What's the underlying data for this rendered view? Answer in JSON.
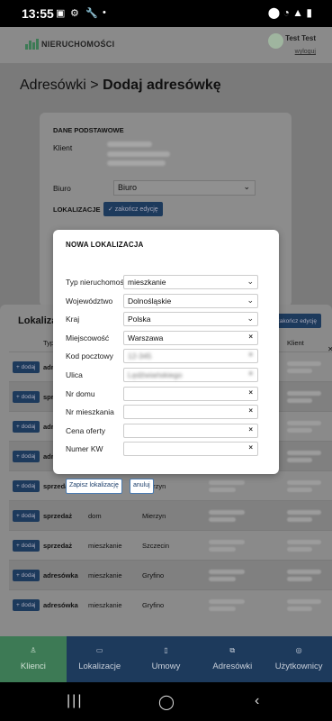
{
  "statusbar": {
    "time": "13:55",
    "dot": "•"
  },
  "header": {
    "logo_text": "NIERUCHOMOŚCI",
    "user_name": "Test Test",
    "logout": "wyloguj"
  },
  "breadcrumb": {
    "parent": "Adresówki",
    "separator": ">",
    "current": "Dodaj adresówkę"
  },
  "card": {
    "section_basic": "DANE PODSTAWOWE",
    "client_label": "Klient",
    "office_label": "Biuro",
    "office_value": "Biuro",
    "section_locations": "LOKALIZACJE",
    "finish_edit_label": "✓ zakończ edycję"
  },
  "panel": {
    "title": "Lokalizacje",
    "finish_edit_label": "✓ zakończ edycję",
    "columns": [
      "Typ",
      "Klient"
    ],
    "add_label": "+ dodaj",
    "rows": [
      {
        "type": "adresówka",
        "kind": "",
        "city": ""
      },
      {
        "type": "sprzedaż",
        "kind": "",
        "city": ""
      },
      {
        "type": "adresówka",
        "kind": "",
        "city": ""
      },
      {
        "type": "adresówka",
        "kind": "",
        "city": ""
      },
      {
        "type": "sprzedaż",
        "kind": "dom",
        "city": "Mierzyn"
      },
      {
        "type": "sprzedaż",
        "kind": "dom",
        "city": "Mierzyn"
      },
      {
        "type": "sprzedaż",
        "kind": "mieszkanie",
        "city": "Szczecin"
      },
      {
        "type": "adresówka",
        "kind": "mieszkanie",
        "city": "Gryfino"
      },
      {
        "type": "adresówka",
        "kind": "mieszkanie",
        "city": "Gryfino"
      }
    ]
  },
  "modal": {
    "title": "NOWA LOKALIZACJA",
    "fields": [
      {
        "label": "Typ nieruchomości",
        "value": "mieszkanie",
        "control": "select"
      },
      {
        "label": "Województwo",
        "value": "Dolnośląskie",
        "control": "select"
      },
      {
        "label": "Kraj",
        "value": "Polska",
        "control": "select"
      },
      {
        "label": "Miejscowość",
        "value": "Warszawa",
        "control": "clear"
      },
      {
        "label": "Kod pocztowy",
        "value": "12-345",
        "control": "clear"
      },
      {
        "label": "Ulica",
        "value": "Lędźwiańskiego",
        "control": "clear"
      },
      {
        "label": "Nr domu",
        "value": "",
        "control": "clear"
      },
      {
        "label": "Nr mieszkania",
        "value": "",
        "control": "clear"
      },
      {
        "label": "Cena oferty",
        "value": "",
        "control": "clear"
      },
      {
        "label": "Numer KW",
        "value": "",
        "control": "clear"
      }
    ],
    "save_label": "Zapisz lokalizację",
    "cancel_label": "anuluj"
  },
  "nav": [
    {
      "label": "Klienci",
      "icon": "person-icon",
      "active": true
    },
    {
      "label": "Lokalizacje",
      "icon": "map-icon",
      "active": false
    },
    {
      "label": "Umowy",
      "icon": "document-icon",
      "active": false
    },
    {
      "label": "Adresówki",
      "icon": "copy-icon",
      "active": false
    },
    {
      "label": "Użytkownicy",
      "icon": "users-icon",
      "active": false
    }
  ],
  "colors": {
    "nav_bg": "#1d3a5c",
    "nav_active": "#3d7a55",
    "button_border": "#4a7bb1"
  }
}
